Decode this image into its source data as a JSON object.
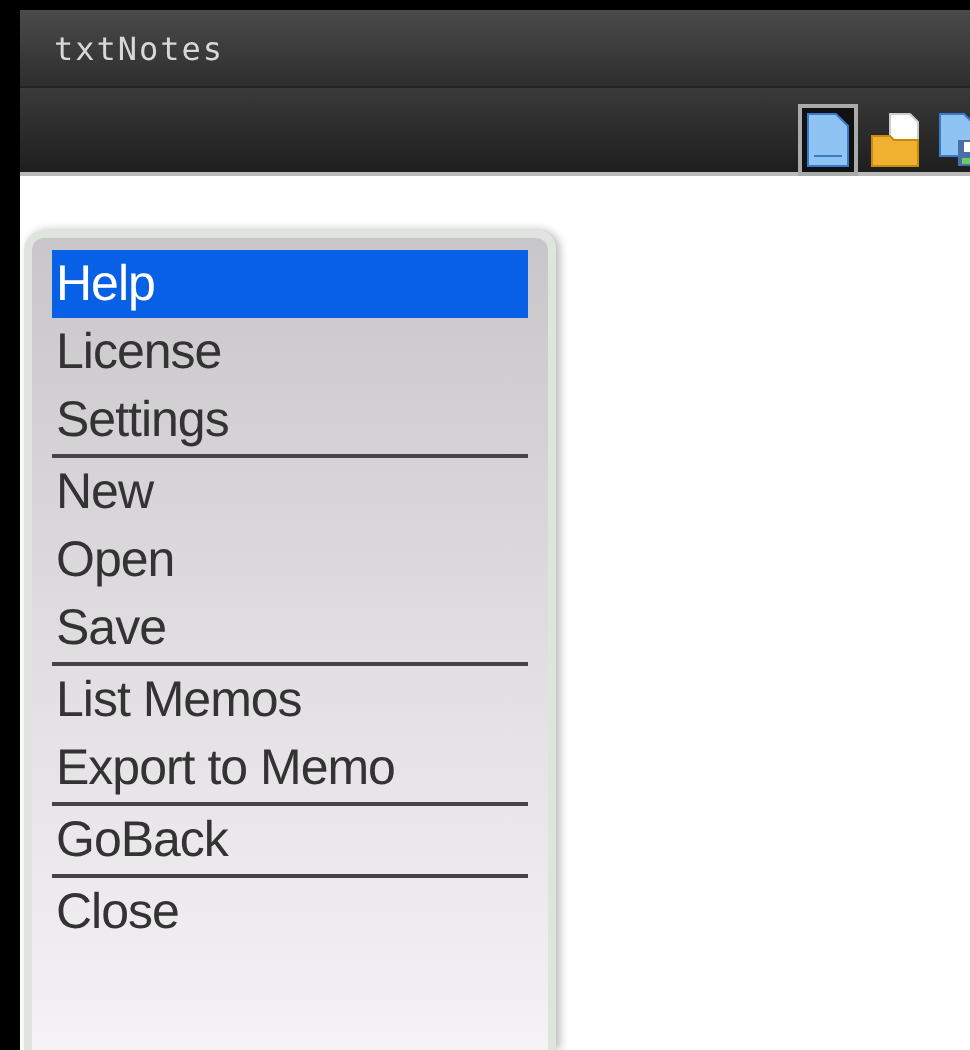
{
  "window": {
    "title": "txtNotes"
  },
  "toolbar": [
    {
      "kind": "new",
      "selected": true
    },
    {
      "kind": "open",
      "selected": false
    },
    {
      "kind": "save",
      "selected": false
    }
  ],
  "menu": [
    [
      {
        "label": "Help",
        "selected": true
      },
      {
        "label": "License",
        "selected": false
      },
      {
        "label": "Settings",
        "selected": false
      }
    ],
    [
      {
        "label": "New",
        "selected": false
      },
      {
        "label": "Open",
        "selected": false
      },
      {
        "label": "Save",
        "selected": false
      }
    ],
    [
      {
        "label": "List Memos",
        "selected": false
      },
      {
        "label": "Export to Memo",
        "selected": false
      }
    ],
    [
      {
        "label": "GoBack",
        "selected": false
      }
    ],
    [
      {
        "label": "Close",
        "selected": false
      }
    ]
  ]
}
